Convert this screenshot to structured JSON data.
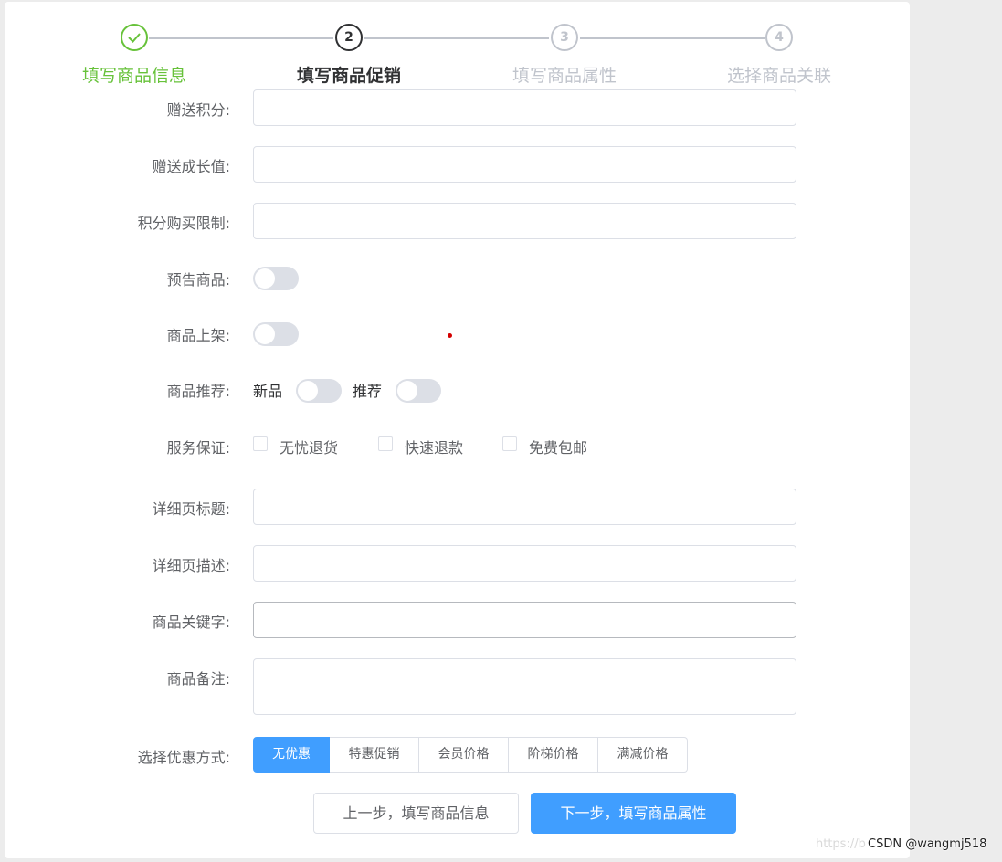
{
  "steps": [
    {
      "number": "✓",
      "title": "填写商品信息",
      "state": "done"
    },
    {
      "number": "2",
      "title": "填写商品促销",
      "state": "active"
    },
    {
      "number": "3",
      "title": "填写商品属性",
      "state": "pending"
    },
    {
      "number": "4",
      "title": "选择商品关联",
      "state": "pending"
    }
  ],
  "form": {
    "gift_points_label": "赠送积分:",
    "gift_points_value": "",
    "gift_growth_label": "赠送成长值:",
    "gift_growth_value": "",
    "points_limit_label": "积分购买限制:",
    "points_limit_value": "",
    "preview_label": "预告商品:",
    "publish_label": "商品上架:",
    "recommend_label": "商品推荐:",
    "recommend_new": "新品",
    "recommend_hot": "推荐",
    "service_label": "服务保证:",
    "service_options": [
      "无忧退货",
      "快速退款",
      "免费包邮"
    ],
    "detail_title_label": "详细页标题:",
    "detail_title_value": "",
    "detail_desc_label": "详细页描述:",
    "detail_desc_value": "",
    "keywords_label": "商品关键字:",
    "keywords_value": "",
    "note_label": "商品备注:",
    "note_value": "",
    "promo_label": "选择优惠方式:",
    "promo_options": [
      "无优惠",
      "特惠促销",
      "会员价格",
      "阶梯价格",
      "满减价格"
    ],
    "promo_selected": "无优惠"
  },
  "buttons": {
    "prev": "上一步，填写商品信息",
    "next": "下一步，填写商品属性"
  },
  "watermark": {
    "faint": "https://b",
    "text": "CSDN @wangmj518"
  },
  "colors": {
    "primary": "#409eff",
    "success": "#67c23a",
    "border": "#dcdfe6"
  }
}
